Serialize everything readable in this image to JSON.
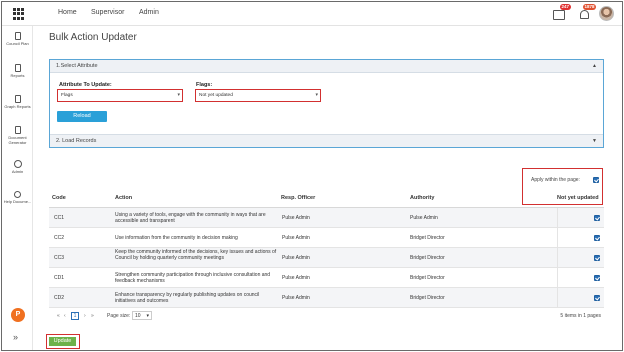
{
  "topbar": {
    "nav": [
      "Home",
      "Supervisor",
      "Admin"
    ],
    "badge_messages": "247",
    "badge_notifications": "1878"
  },
  "sidebar": {
    "items": [
      {
        "label": "Council Plan",
        "icon": "clipboard-icon"
      },
      {
        "label": "Reports",
        "icon": "document-icon"
      },
      {
        "label": "Graph Reports",
        "icon": "graph-report-icon"
      },
      {
        "label": "Document Generator",
        "icon": "document-generator-icon"
      },
      {
        "label": "Admin",
        "icon": "users-icon"
      },
      {
        "label": "Help Docume...",
        "icon": "help-icon"
      }
    ]
  },
  "page": {
    "title": "Bulk Action Updater"
  },
  "select_attribute": {
    "heading": "1.Select Attribute",
    "attribute_label": "Attribute To Update:",
    "attribute_value": "Flags",
    "flags_label": "Flags:",
    "flags_value": "Not yet updated",
    "reload_label": "Reload"
  },
  "load_records": {
    "heading": "2. Load Records"
  },
  "table": {
    "apply_label": "Apply within the page:",
    "apply_checked": true,
    "columns": {
      "code": "Code",
      "action": "Action",
      "officer": "Resp. Officer",
      "authority": "Authority",
      "flag": "Not yet updated"
    },
    "rows": [
      {
        "code": "CC1",
        "action": "Using a variety of tools, engage with the community in ways that are accessible and transparent",
        "officer": "Pulse Admin",
        "authority": "Pulse Admin",
        "checked": true
      },
      {
        "code": "CC2",
        "action": "Use information from the community in decision making",
        "officer": "Pulse Admin",
        "authority": "Bridget Director",
        "checked": true
      },
      {
        "code": "CC3",
        "action": "Keep the community informed of the decisions, key issues and actions of Council by holding quarterly community meetings",
        "officer": "Pulse Admin",
        "authority": "Bridget Director",
        "checked": true
      },
      {
        "code": "CD1",
        "action": "Strengthen community participation through inclusive consultation and feedback mechanisms",
        "officer": "Pulse Admin",
        "authority": "Bridget Director",
        "checked": true
      },
      {
        "code": "CD2",
        "action": "Enhance transparency by regularly publishing updates on council initiatives and outcomes",
        "officer": "Pulse Admin",
        "authority": "Bridget Director",
        "checked": true
      }
    ]
  },
  "pager": {
    "first": "«",
    "prev": "‹",
    "current": "1",
    "next": "›",
    "last": "»",
    "page_size_label": "Page size:",
    "page_size_value": "10",
    "summary": "5 items in 1 pages"
  },
  "update_label": "Update"
}
